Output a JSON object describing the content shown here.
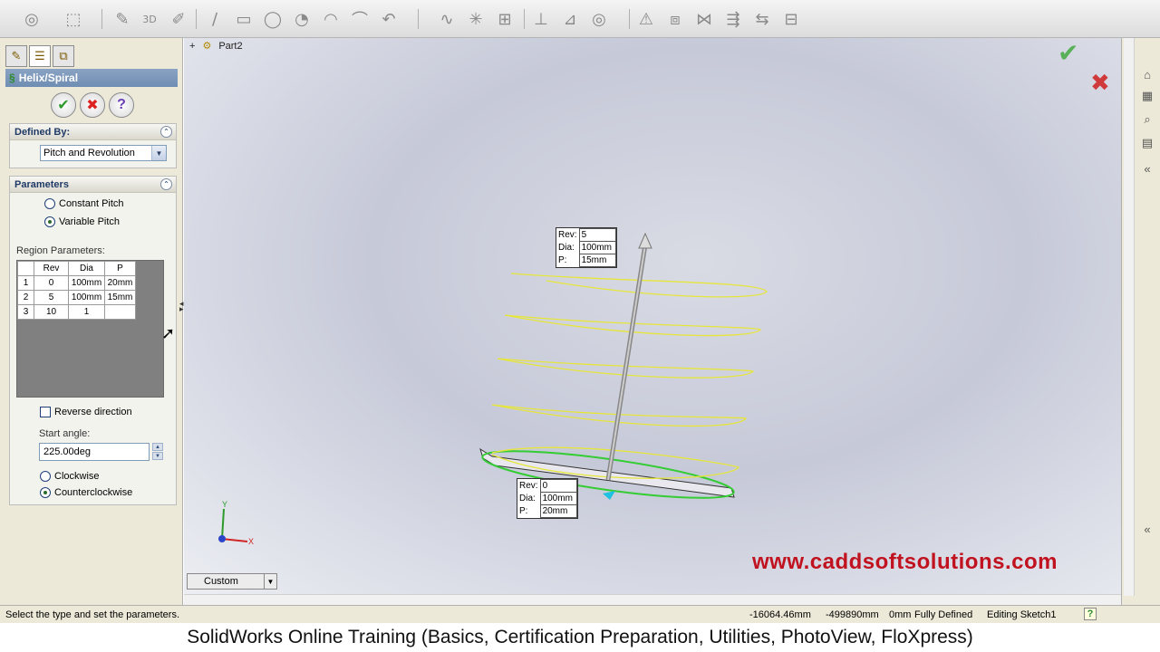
{
  "toolbar": {
    "icons": [
      "sketch-icon",
      "smart-dimension-icon",
      "3d-sketch-icon",
      "line-icon",
      "rectangle-icon",
      "circle-icon",
      "arc-icon",
      "spline-icon",
      "point-icon",
      "plane-icon",
      "trim-icon",
      "offset-icon",
      "mirror-icon",
      "pattern-icon",
      "relations-icon"
    ],
    "glyphs": [
      "◎",
      "⬚",
      "3D",
      "∕",
      "▭",
      "◯",
      "◔",
      "◠",
      "∿",
      "✳",
      "⊞",
      "⊥",
      "◇",
      "⋈",
      "⇶",
      "⊟",
      "⊡",
      "⊿",
      "⧈"
    ]
  },
  "panel": {
    "title": "Helix/Spiral",
    "defined_by": {
      "header": "Defined By:",
      "value": "Pitch and Revolution"
    },
    "parameters": {
      "header": "Parameters",
      "constant_pitch": "Constant Pitch",
      "variable_pitch": "Variable Pitch",
      "selected": "variable_pitch",
      "region_label": "Region Parameters:",
      "columns": [
        "",
        "Rev",
        "Dia",
        "P"
      ],
      "rows": [
        [
          "1",
          "0",
          "100mm",
          "20mm"
        ],
        [
          "2",
          "5",
          "100mm",
          "15mm"
        ],
        [
          "3",
          "10",
          "1",
          ""
        ]
      ],
      "reverse_direction": "Reverse direction",
      "start_angle_label": "Start angle:",
      "start_angle_value": "225.00deg",
      "clockwise": "Clockwise",
      "counterclockwise": "Counterclockwise",
      "rotation_selected": "counterclockwise"
    }
  },
  "viewport": {
    "breadcrumb": "Part2",
    "callout_top": {
      "rev_label": "Rev:",
      "rev": "5",
      "dia_label": "Dia:",
      "dia": "100mm",
      "p_label": "P:",
      "p": "15mm"
    },
    "callout_bottom": {
      "rev_label": "Rev:",
      "rev": "0",
      "dia_label": "Dia:",
      "dia": "100mm",
      "p_label": "P:",
      "p": "20mm"
    },
    "view_orientation": "Custom",
    "watermark": "www.caddsoftsolutions.com",
    "axis_x": "X",
    "axis_y": "Y",
    "colors": {
      "helix": "#e6e63a",
      "sketch_circle": "#33cc33",
      "axis": "#ff2b2b"
    }
  },
  "statusbar": {
    "message": "Select the type and set the parameters.",
    "x_coord": "-16064.46mm",
    "y_coord": "-499890mm",
    "z_coord": "0mm",
    "state": "Fully Defined",
    "mode": "Editing Sketch1"
  },
  "caption": "SolidWorks Online Training (Basics, Certification Preparation, Utilities, PhotoView, FloXpress)"
}
